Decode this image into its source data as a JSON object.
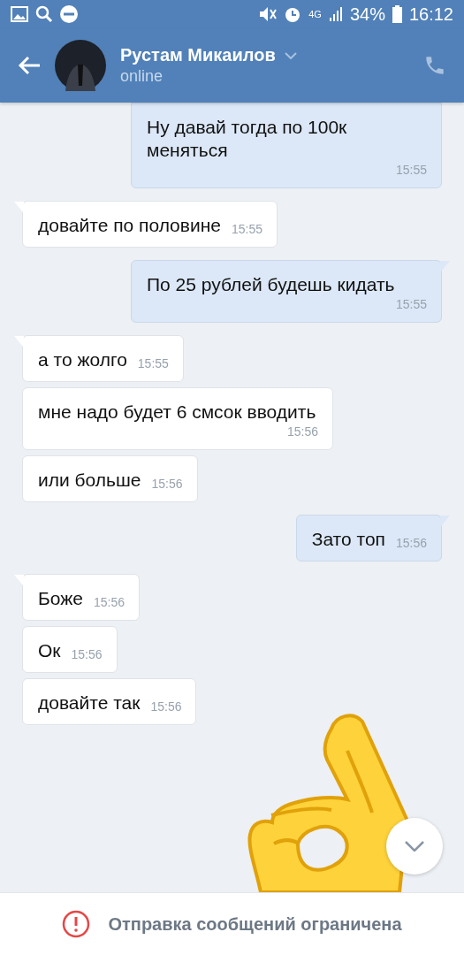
{
  "status_bar": {
    "network": "4G",
    "battery": "34%",
    "time": "16:12"
  },
  "header": {
    "name": "Рустам Микаилов",
    "status": "online"
  },
  "messages": [
    {
      "outgoing": true,
      "text": "Ну давай тогда по 100к меняться",
      "time": "15:55"
    },
    {
      "outgoing": false,
      "text": "довайте по половине",
      "time": "15:55"
    },
    {
      "outgoing": true,
      "text": "По 25 рублей будешь кидать",
      "time": "15:55"
    },
    {
      "outgoing": false,
      "text": "а то жолго",
      "time": "15:55"
    },
    {
      "outgoing": false,
      "text": "мне надо будет 6 смсок вводить",
      "time": "15:56"
    },
    {
      "outgoing": false,
      "text": "или больше",
      "time": "15:56"
    },
    {
      "outgoing": true,
      "text": "Зато топ",
      "time": "15:56"
    },
    {
      "outgoing": false,
      "text": "Боже",
      "time": "15:56"
    },
    {
      "outgoing": false,
      "text": "Ок",
      "time": "15:56"
    },
    {
      "outgoing": false,
      "text": "довайте так",
      "time": "15:56"
    }
  ],
  "notice": "Отправка сообщений ограничена"
}
